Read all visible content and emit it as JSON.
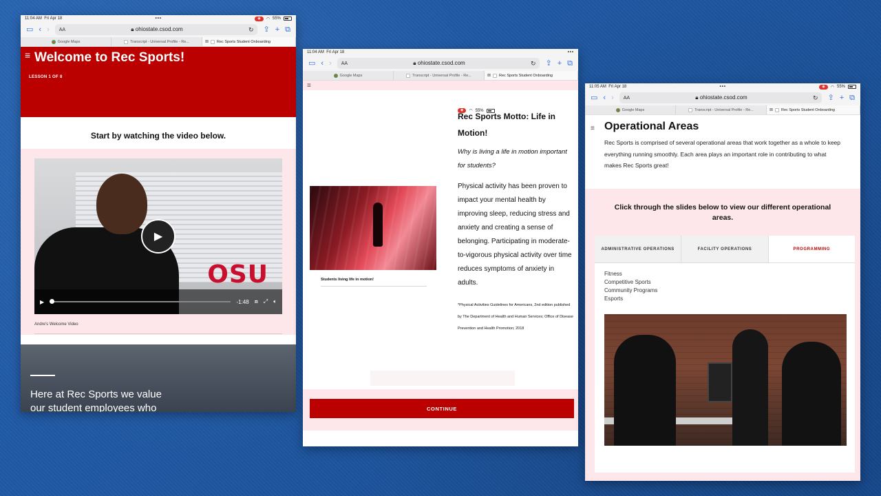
{
  "browser": {
    "url": "ohiostate.csod.com",
    "aa_label": "AA",
    "tabs": [
      {
        "label": "Google Maps"
      },
      {
        "label": "Transcript - Universal Profile - Re..."
      },
      {
        "label": "Rec Sports Student Onboarding"
      }
    ]
  },
  "screen1": {
    "status": {
      "time": "11:04 AM",
      "date": "Fri Apr 18",
      "battery": "55%"
    },
    "title": "Welcome to Rec Sports!",
    "lesson": "LESSON 1 OF 8",
    "intro": "Start by watching the video below.",
    "video": {
      "remaining": "-1:48",
      "wall_text": "OSU"
    },
    "caption": "Andre's Welcome Video",
    "banner_line1": "Here at Rec Sports we value",
    "banner_line2": "our student employees who"
  },
  "screen2": {
    "status": {
      "time": "11:04 AM",
      "date": "Fri Apr 18",
      "battery": "55%"
    },
    "heading": "Rec Sports Motto: Life in Motion!",
    "question": "Why is living a life in motion important for students?",
    "paragraph": "Physical activity has been proven to impact your mental health by improving sleep, reducing stress and anxiety and creating a sense of belonging. Participating in moderate-to-vigorous physical activity over time reduces symptoms of anxiety in adults.",
    "footnote": "*Physical Activities Guidelines for Americans, 2nd edition published by The Department of Health and Human Services; Office of Disease Prevention and Health Promotion; 2018",
    "image_caption": "Students living life in motion!",
    "continue_label": "CONTINUE"
  },
  "screen3": {
    "status": {
      "time": "11:05 AM",
      "date": "Fri Apr 18",
      "battery": "55%"
    },
    "heading": "Operational Areas",
    "description": "Rec Sports is comprised of several operational areas that work together as a whole to keep everything running smoothly. Each area plays an important role in contributing to what makes Rec Sports great!",
    "prompt": "Click through the slides below to view our different operational areas.",
    "tabs": [
      {
        "label": "ADMINISTRATIVE OPERATIONS"
      },
      {
        "label": "FACILITY OPERATIONS"
      },
      {
        "label": "PROGRAMMING"
      }
    ],
    "programs": [
      "Fitness",
      "Competitive Sports",
      "Community Programs",
      "Esports"
    ]
  },
  "colors": {
    "scarlet": "#bb0000",
    "pink_bg": "#fde7ea",
    "safari_blue": "#2f6fde",
    "backdrop": "#1c54a0"
  }
}
